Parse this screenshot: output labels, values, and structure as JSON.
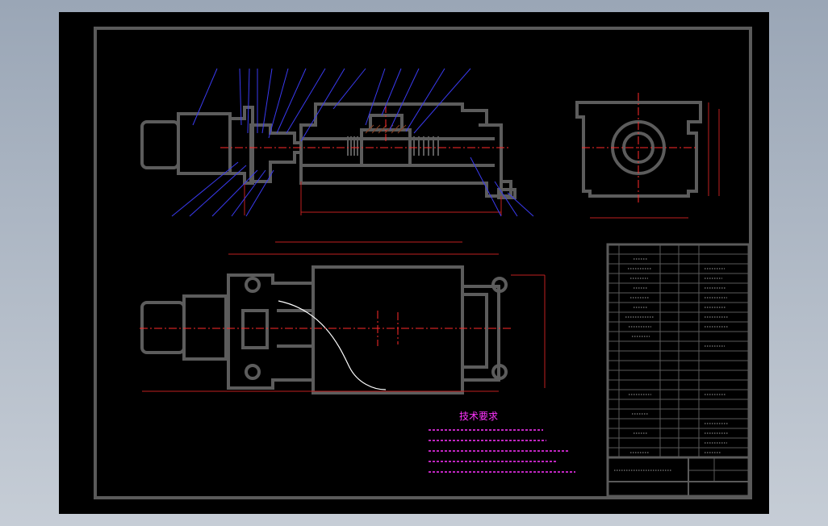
{
  "drawing": {
    "background": "#000000",
    "frame_color": "#5a5a5a",
    "outline_color": "#5c5c5c",
    "leader_color": "#3a3af0",
    "centerline_color": "#ff2a2a",
    "dimension_color": "#d02020",
    "note_color": "#ff33ff",
    "tech_requirements_title": "技术要求"
  }
}
